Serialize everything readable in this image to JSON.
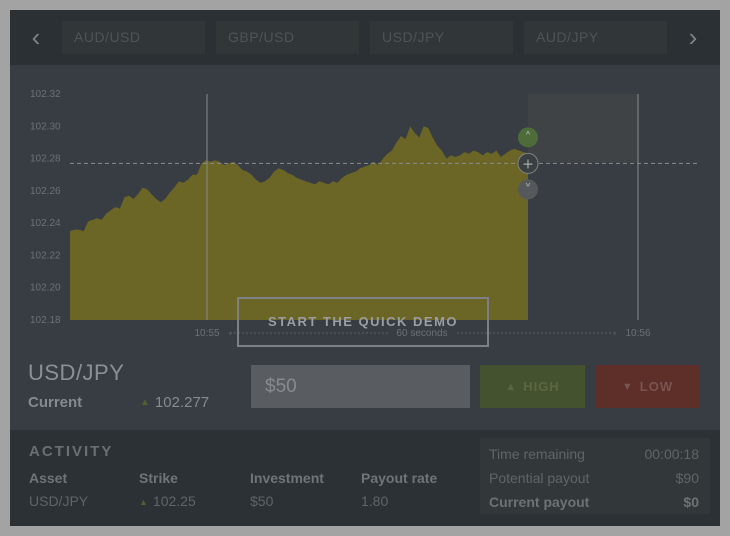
{
  "assets": [
    "AUD/USD",
    "GBP/USD",
    "USD/JPY",
    "AUD/JPY"
  ],
  "demo_button_label": "START THE QUICK DEMO",
  "chart_data": {
    "type": "area",
    "y_ticks": [
      "102.32",
      "102.30",
      "102.28",
      "102.26",
      "102.24",
      "102.22",
      "102.20",
      "102.18"
    ],
    "ylim": [
      102.18,
      102.32
    ],
    "x_labels": [
      "10:55",
      "60 seconds",
      "10:56"
    ],
    "strike": 102.277,
    "series": [
      {
        "values": [
          102.235,
          102.236,
          102.236,
          102.235,
          102.241,
          102.242,
          102.243,
          102.242,
          102.246,
          102.248,
          102.25,
          102.249,
          102.256,
          102.257,
          102.255,
          102.258,
          102.262,
          102.261,
          102.258,
          102.255,
          102.253,
          102.255,
          102.259,
          102.262,
          102.266,
          102.265,
          102.267,
          102.27,
          102.27,
          102.277,
          102.279,
          102.278,
          102.279,
          102.278,
          102.276,
          102.277,
          102.278,
          102.276,
          102.273,
          102.272,
          102.27,
          102.267,
          102.265,
          102.266,
          102.268,
          102.272,
          102.274,
          102.273,
          102.271,
          102.27,
          102.268,
          102.267,
          102.266,
          102.265,
          102.264,
          102.266,
          102.265,
          102.264,
          102.266,
          102.265,
          102.268,
          102.27,
          102.271,
          102.272,
          102.274,
          102.275,
          102.276,
          102.278,
          102.276,
          102.28,
          102.283,
          102.285,
          102.29,
          102.294,
          102.292,
          102.3,
          102.296,
          102.293,
          102.3,
          102.299,
          102.293,
          102.288,
          102.285,
          102.28,
          102.282,
          102.281,
          102.282,
          102.284,
          102.283,
          102.285,
          102.284,
          102.282,
          102.284,
          102.283,
          102.285,
          102.281,
          102.283,
          102.285,
          102.286,
          102.285,
          102.284,
          102.283
        ]
      }
    ]
  },
  "trade": {
    "asset": "USD/JPY",
    "current_label": "Current",
    "current_value": "102.277",
    "amount": "$50",
    "high_label": "HIGH",
    "low_label": "LOW"
  },
  "activity": {
    "title": "ACTIVITY",
    "columns": [
      "Asset",
      "Strike",
      "Investment",
      "Payout rate"
    ],
    "row": {
      "asset": "USD/JPY",
      "strike": "102.25",
      "investment": "$50",
      "payout_rate": "1.80"
    },
    "summary": [
      {
        "label": "Time remaining",
        "value": "00:00:18"
      },
      {
        "label": "Potential payout",
        "value": "$90"
      },
      {
        "label": "Current payout",
        "value": "$0"
      }
    ]
  },
  "colors": {
    "area_fill": "#6b6526",
    "high": "#45522f",
    "low": "#5e2e29",
    "up_marker": "#4e6b3a"
  }
}
